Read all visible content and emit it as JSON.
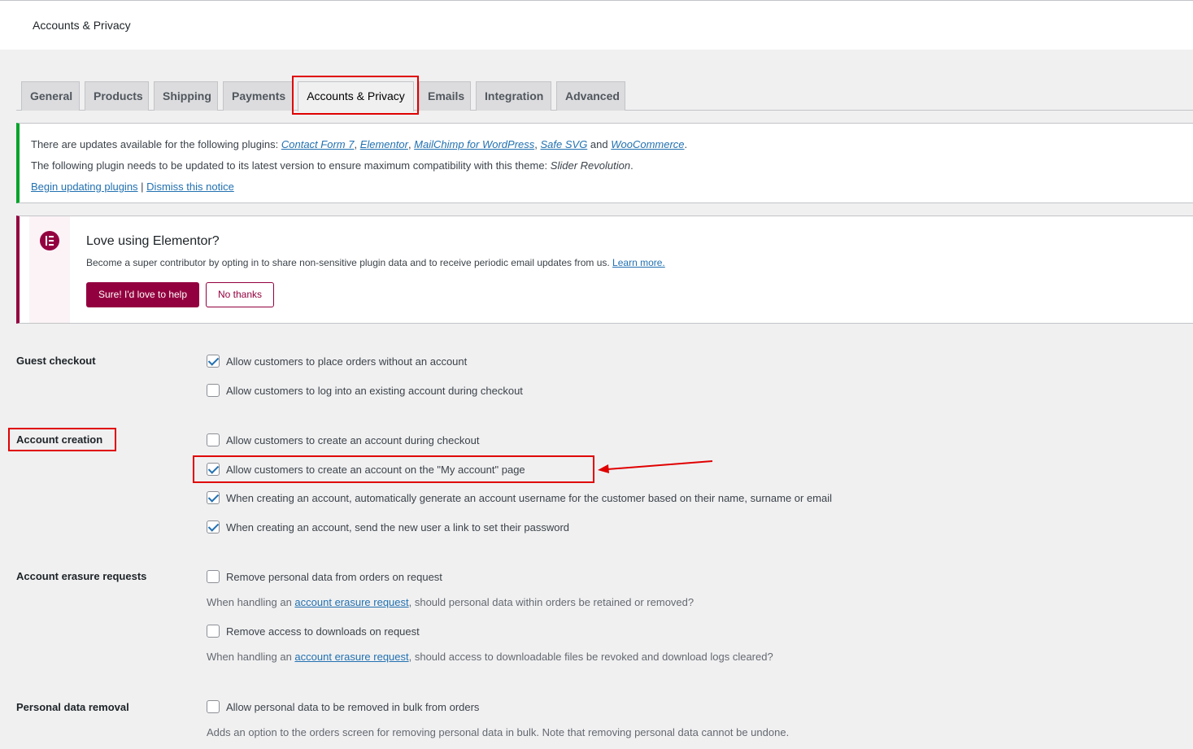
{
  "header": {
    "title": "Accounts & Privacy"
  },
  "tabs": [
    {
      "label": "General"
    },
    {
      "label": "Products"
    },
    {
      "label": "Shipping"
    },
    {
      "label": "Payments"
    },
    {
      "label": "Accounts & Privacy"
    },
    {
      "label": "Emails"
    },
    {
      "label": "Integration"
    },
    {
      "label": "Advanced"
    }
  ],
  "updates_notice": {
    "line1_prefix": "There are updates available for the following plugins: ",
    "plugins": [
      "Contact Form 7",
      "Elementor",
      "MailChimp for WordPress",
      "Safe SVG",
      "WooCommerce"
    ],
    "sep_comma": ", ",
    "sep_and": " and ",
    "period": ".",
    "line2_prefix": "The following plugin needs to be updated to its latest version to ensure maximum compatibility with this theme: ",
    "line2_plugin": "Slider Revolution",
    "begin_link": "Begin updating plugins",
    "divider": " | ",
    "dismiss_link": "Dismiss this notice"
  },
  "elementor_notice": {
    "heading": "Love using Elementor?",
    "body": "Become a super contributor by opting in to share non-sensitive plugin data and to receive periodic email updates from us. ",
    "learn_more": "Learn more.",
    "primary_button": "Sure! I'd love to help",
    "secondary_button": "No thanks",
    "accent_color": "#93003f"
  },
  "settings": {
    "guest_checkout": {
      "label": "Guest checkout",
      "options": [
        {
          "text": "Allow customers to place orders without an account",
          "checked": true
        },
        {
          "text": "Allow customers to log into an existing account during checkout",
          "checked": false
        }
      ]
    },
    "account_creation": {
      "label": "Account creation",
      "options": [
        {
          "text": "Allow customers to create an account during checkout",
          "checked": false
        },
        {
          "text": "Allow customers to create an account on the \"My account\" page",
          "checked": true
        },
        {
          "text": "When creating an account, automatically generate an account username for the customer based on their name, surname or email",
          "checked": true
        },
        {
          "text": "When creating an account, send the new user a link to set their password",
          "checked": true
        }
      ]
    },
    "erasure": {
      "label": "Account erasure requests",
      "options": [
        {
          "text": "Remove personal data from orders on request",
          "checked": false
        },
        {
          "text": "Remove access to downloads on request",
          "checked": false
        }
      ],
      "desc1_prefix": "When handling an ",
      "desc1_link": "account erasure request",
      "desc1_suffix": ", should personal data within orders be retained or removed?",
      "desc2_prefix": "When handling an ",
      "desc2_link": "account erasure request",
      "desc2_suffix": ", should access to downloadable files be revoked and download logs cleared?"
    },
    "personal_data_removal": {
      "label": "Personal data removal",
      "options": [
        {
          "text": "Allow personal data to be removed in bulk from orders",
          "checked": false
        }
      ],
      "desc": "Adds an option to the orders screen for removing personal data in bulk. Note that removing personal data cannot be undone."
    }
  },
  "annotation_color": "#e00000"
}
